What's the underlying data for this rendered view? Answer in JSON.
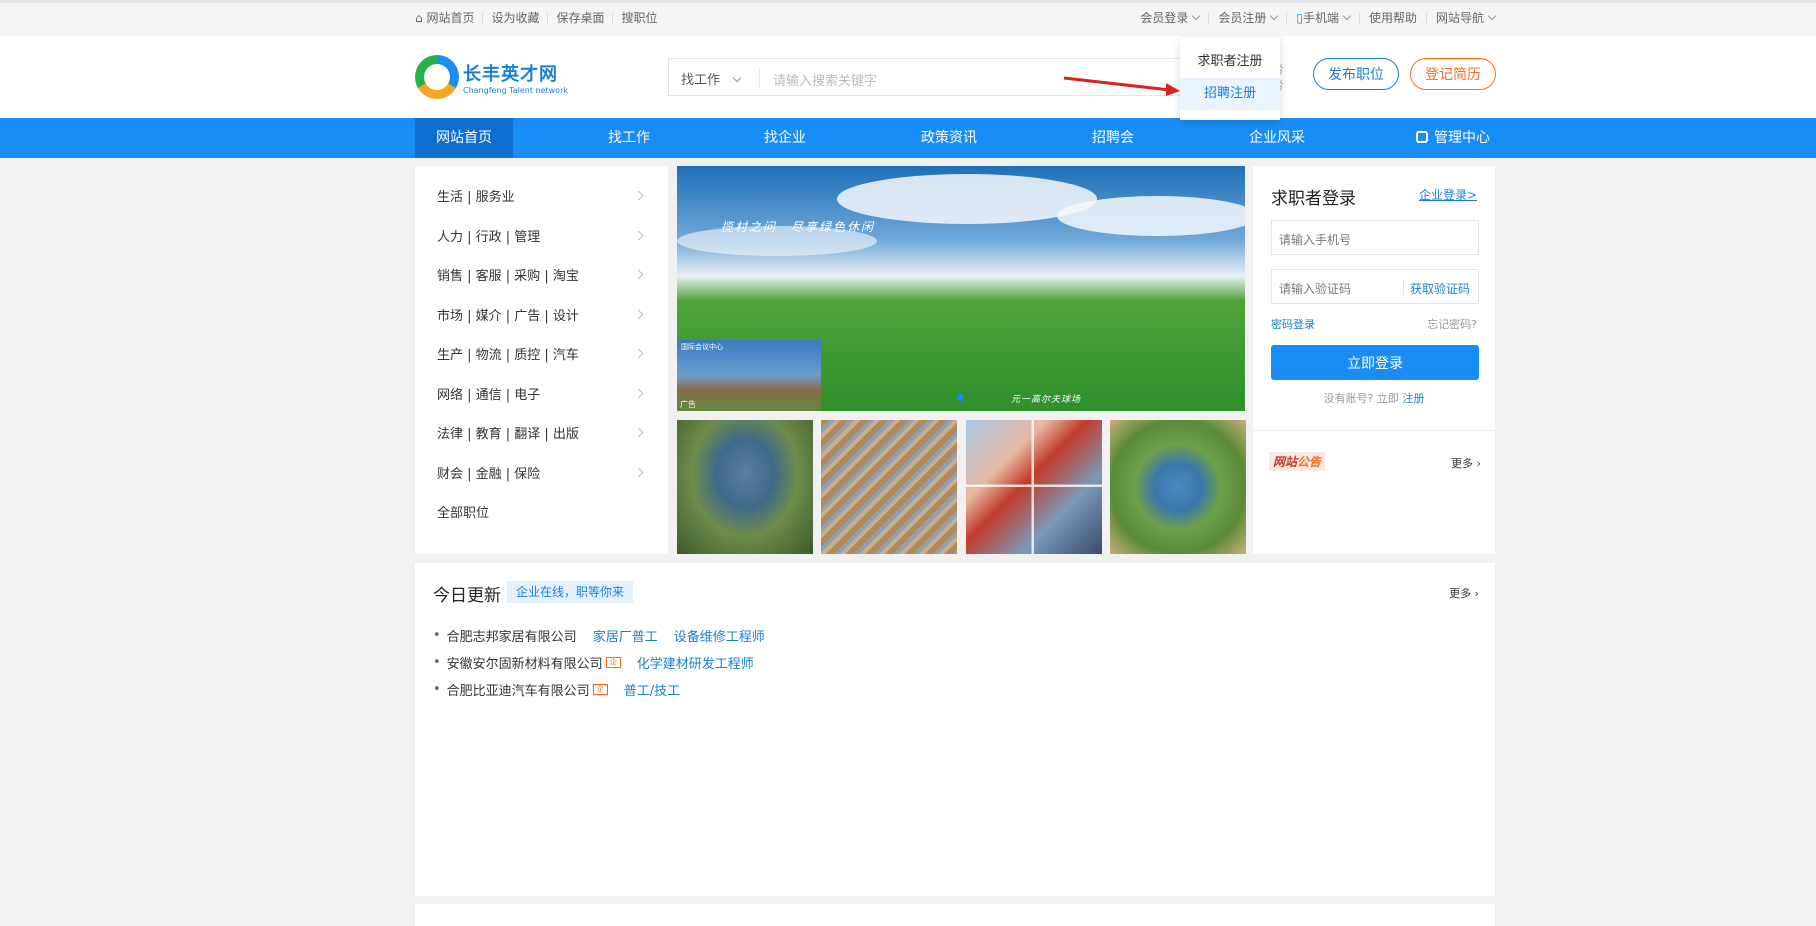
{
  "topbar": {
    "left": [
      "网站首页",
      "设为收藏",
      "保存桌面",
      "搜职位"
    ],
    "right": [
      "会员登录",
      "会员注册",
      "手机端",
      "使用帮助",
      "网站导航"
    ]
  },
  "header": {
    "logo_cn": "长丰英才网",
    "logo_en": "Changfeng Talent network",
    "search_category": "找工作",
    "search_placeholder": "请输入搜索关键字",
    "search_side_1": "索",
    "search_side_2": "索",
    "post_job": "发布职位",
    "register_resume": "登记简历"
  },
  "dropdown": {
    "items": [
      "求职者注册",
      "招聘注册"
    ],
    "active_index": 1
  },
  "nav": {
    "items": [
      "网站首页",
      "找工作",
      "找企业",
      "政策资讯",
      "招聘会",
      "企业风采",
      "管理中心"
    ],
    "active_index": 0
  },
  "categories": [
    "生活 | 服务业",
    "人力 | 行政 | 管理",
    "销售 | 客服 | 采购 | 淘宝",
    "市场 | 媒介 | 广告 | 设计",
    "生产 | 物流 | 质控 | 汽车",
    "网络 | 通信 | 电子",
    "法律 | 教育 | 翻译 | 出版",
    "财会 | 金融 | 保险",
    "全部职位"
  ],
  "banner": {
    "slogan": "揽村之问　尽享绿色休闲",
    "caption": "元一高尔夫球场",
    "inset_caption": "国际会议中心",
    "ad_label": "广告"
  },
  "login": {
    "title": "求职者登录",
    "enterprise_link": "企业登录>",
    "phone_placeholder": "请输入手机号",
    "code_placeholder": "请输入验证码",
    "get_code": "获取验证码",
    "password_login": "密码登录",
    "forgot": "忘记密码?",
    "submit": "立即登录",
    "no_account": "没有账号? 立即 ",
    "register": "注册",
    "notice_a": "网站",
    "notice_b": "公告",
    "more": "更多"
  },
  "today": {
    "title": "今日更新",
    "tag": "企业在线，职等你来",
    "more": "更多",
    "rows": [
      {
        "company": "合肥志邦家居有限公司",
        "badge": false,
        "jobs": [
          "家居厂普工",
          "设备维修工程师"
        ]
      },
      {
        "company": "安徽安尔固新材料有限公司",
        "badge": true,
        "jobs": [
          "化学建材研发工程师"
        ]
      },
      {
        "company": "合肥比亚迪汽车有限公司",
        "badge": true,
        "jobs": [
          "普工/技工"
        ]
      }
    ],
    "badge_text": "企"
  },
  "colors": {
    "primary": "#1a8cf5",
    "accent_orange": "#ff6a1a",
    "link": "#1a7fd6"
  }
}
